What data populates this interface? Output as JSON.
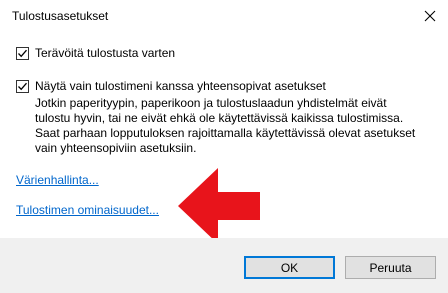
{
  "window": {
    "title": "Tulostusasetukset",
    "close_icon": "close-icon"
  },
  "options": [
    {
      "label": "Terävöitä tulostusta varten",
      "checked": true
    },
    {
      "label": "Näytä vain tulostimeni kanssa yhteensopivat asetukset",
      "checked": true
    }
  ],
  "description": [
    "Jotkin paperityypin, paperikoon ja tulostuslaadun yhdistelmät eivät",
    "tulostu hyvin, tai ne eivät ehkä ole käytettävissä kaikissa tulostimissa.",
    "Saat parhaan lopputuloksen rajoittamalla käytettävissä olevat asetukset",
    "vain yhteensopiviin asetuksiin."
  ],
  "links": {
    "color_management": "Värienhallinta...",
    "printer_properties": "Tulostimen ominaisuudet..."
  },
  "annotation": {
    "icon": "red-arrow-icon",
    "color": "#e8141b"
  },
  "buttons": {
    "ok": "OK",
    "cancel": "Peruuta"
  },
  "colors": {
    "link": "#0066cc",
    "accent": "#0078d7",
    "footer": "#f0f0f0"
  }
}
